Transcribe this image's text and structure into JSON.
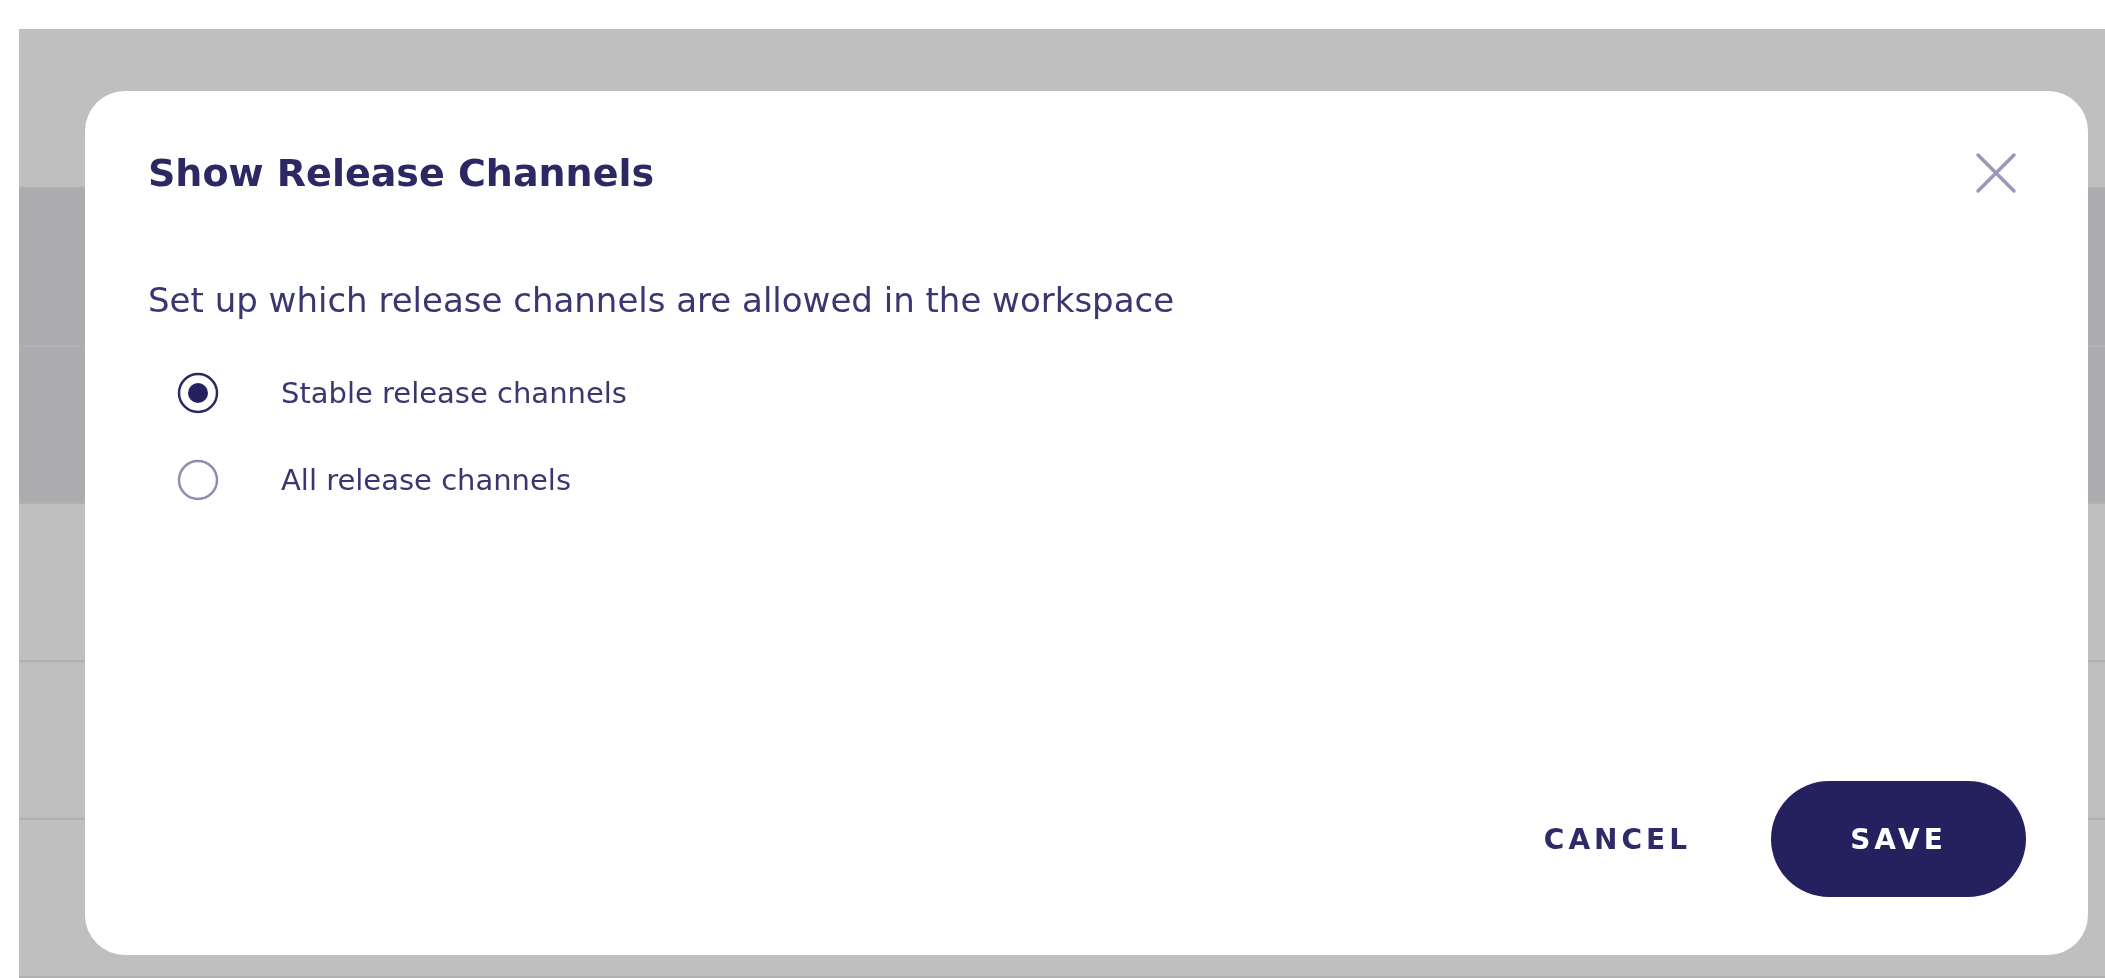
{
  "dialog": {
    "title": "Show Release Channels",
    "description": "Set up which release channels are allowed in the workspace",
    "options": [
      {
        "label": "Stable release channels",
        "selected": true
      },
      {
        "label": "All release channels",
        "selected": false
      }
    ],
    "buttons": [
      {
        "label": "CANCEL",
        "kind": "text"
      },
      {
        "label": "SAVE",
        "kind": "primary"
      }
    ]
  }
}
